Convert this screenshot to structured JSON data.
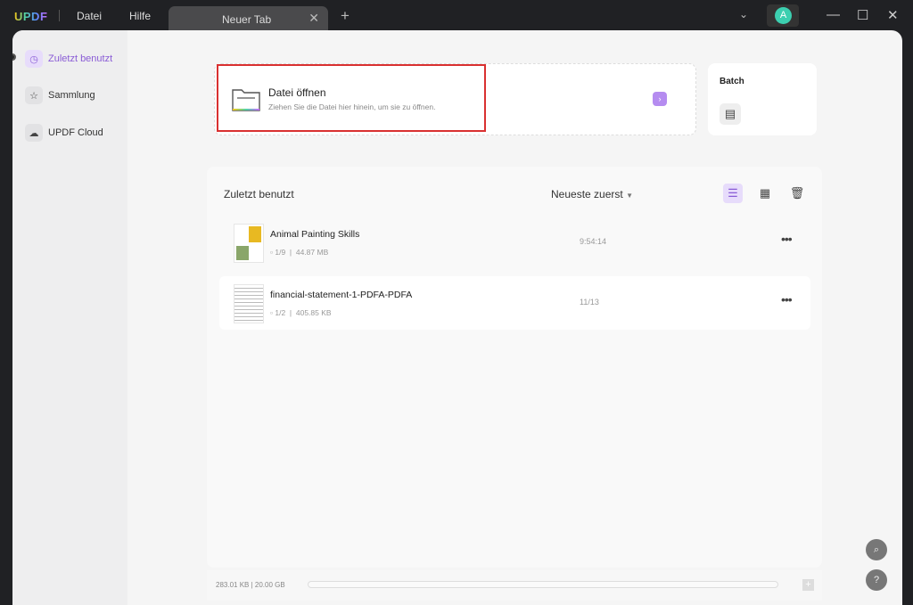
{
  "app": {
    "logo": "UPDF",
    "menu": [
      "Datei",
      "Hilfe"
    ],
    "tab": "Neuer Tab",
    "avatar": "A"
  },
  "sidebar": {
    "items": [
      {
        "label": "Zuletzt benutzt",
        "icon": "clock-icon",
        "active": true
      },
      {
        "label": "Sammlung",
        "icon": "star-icon"
      },
      {
        "label": "UPDF Cloud",
        "icon": "cloud-icon"
      }
    ]
  },
  "open": {
    "title": "Datei öffnen",
    "subtitle": "Ziehen Sie die Datei hier hinein, um sie zu öffnen."
  },
  "batch": {
    "title": "Batch"
  },
  "recent": {
    "title": "Zuletzt benutzt",
    "sort": "Neueste zuerst",
    "files": [
      {
        "name": "Animal Painting Skills",
        "pages": "1/9",
        "size": "44.87 MB",
        "time": "9:54:14"
      },
      {
        "name": "financial-statement-1-PDFA-PDFA",
        "pages": "1/2",
        "size": "405.85 KB",
        "time": "11/13"
      }
    ]
  },
  "footer": {
    "storage": "283.01 KB | 20.00 GB",
    "used_fraction": 1.38e-05
  },
  "colors": {
    "accent": "#8a5cd6",
    "highlight": "#d93030"
  }
}
